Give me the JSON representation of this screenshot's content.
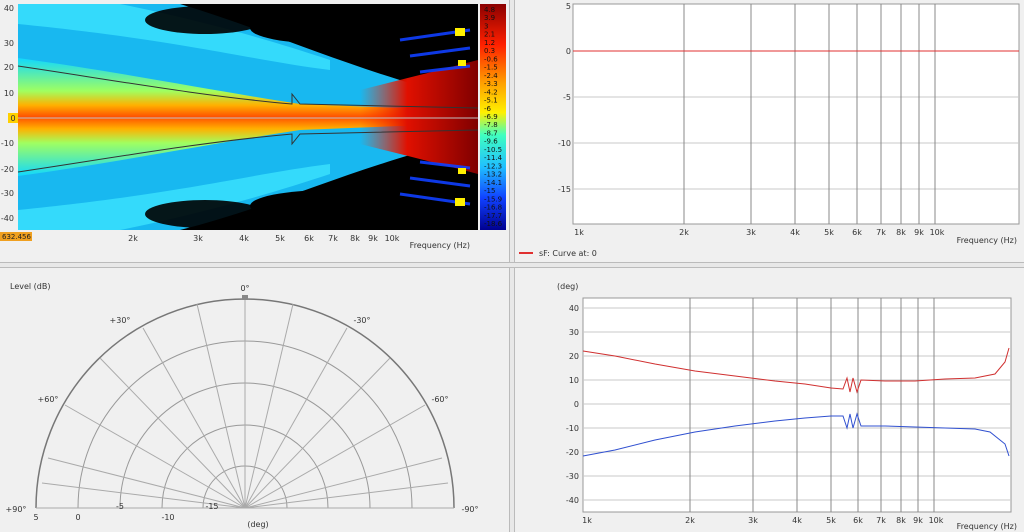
{
  "sonogram": {
    "y_ticks": [
      "40",
      "30",
      "20",
      "10",
      "0",
      "-10",
      "-20",
      "-30",
      "-40"
    ],
    "x_ticks": [
      "2k",
      "3k",
      "4k",
      "5k",
      "6k",
      "7k",
      "8k",
      "9k",
      "10k"
    ],
    "x_unit": "Frequency  (Hz)",
    "cursor_readout": "632.456",
    "zero_marker": "0",
    "scale": [
      "4.8",
      "3.9",
      "3",
      "2.1",
      "1.2",
      "0.3",
      "-0.6",
      "-1.5",
      "-2.4",
      "-3.3",
      "-4.2",
      "-5.1",
      "-6",
      "-6.9",
      "-7.8",
      "-8.7",
      "-9.6",
      "-10.5",
      "-11.4",
      "-12.3",
      "-13.2",
      "-14.1",
      "-15",
      "-15.9",
      "-16.8",
      "-17.7",
      "-18.6"
    ]
  },
  "top_right": {
    "y_ticks": [
      "5",
      "0",
      "-5",
      "-10",
      "-15"
    ],
    "x_ticks": [
      "1k",
      "2k",
      "3k",
      "4k",
      "5k",
      "6k",
      "7k",
      "8k",
      "9k",
      "10k"
    ],
    "x_unit": "Frequency  (Hz)",
    "legend": "sF: Curve at: 0",
    "legend_color": "#e03030"
  },
  "polar": {
    "level_label": "Level  (dB)",
    "angles": {
      "top": "0°",
      "p30": "+30°",
      "m30": "-30°",
      "p60": "+60°",
      "m60": "-60°",
      "p90": "+90°",
      "m90": "-90°"
    },
    "radial": [
      "5",
      "0",
      "-5",
      "-10",
      "-15"
    ],
    "unit": "(deg)"
  },
  "bottom_right": {
    "y_unit": "(deg)",
    "y_ticks": [
      "40",
      "30",
      "20",
      "10",
      "0",
      "-10",
      "-20",
      "-30",
      "-40"
    ],
    "x_ticks": [
      "1k",
      "2k",
      "3k",
      "4k",
      "5k",
      "6k",
      "7k",
      "8k",
      "9k",
      "10k"
    ],
    "x_unit": "Frequency  (Hz)",
    "red_color": "#d03030",
    "blue_color": "#3050d0"
  }
}
